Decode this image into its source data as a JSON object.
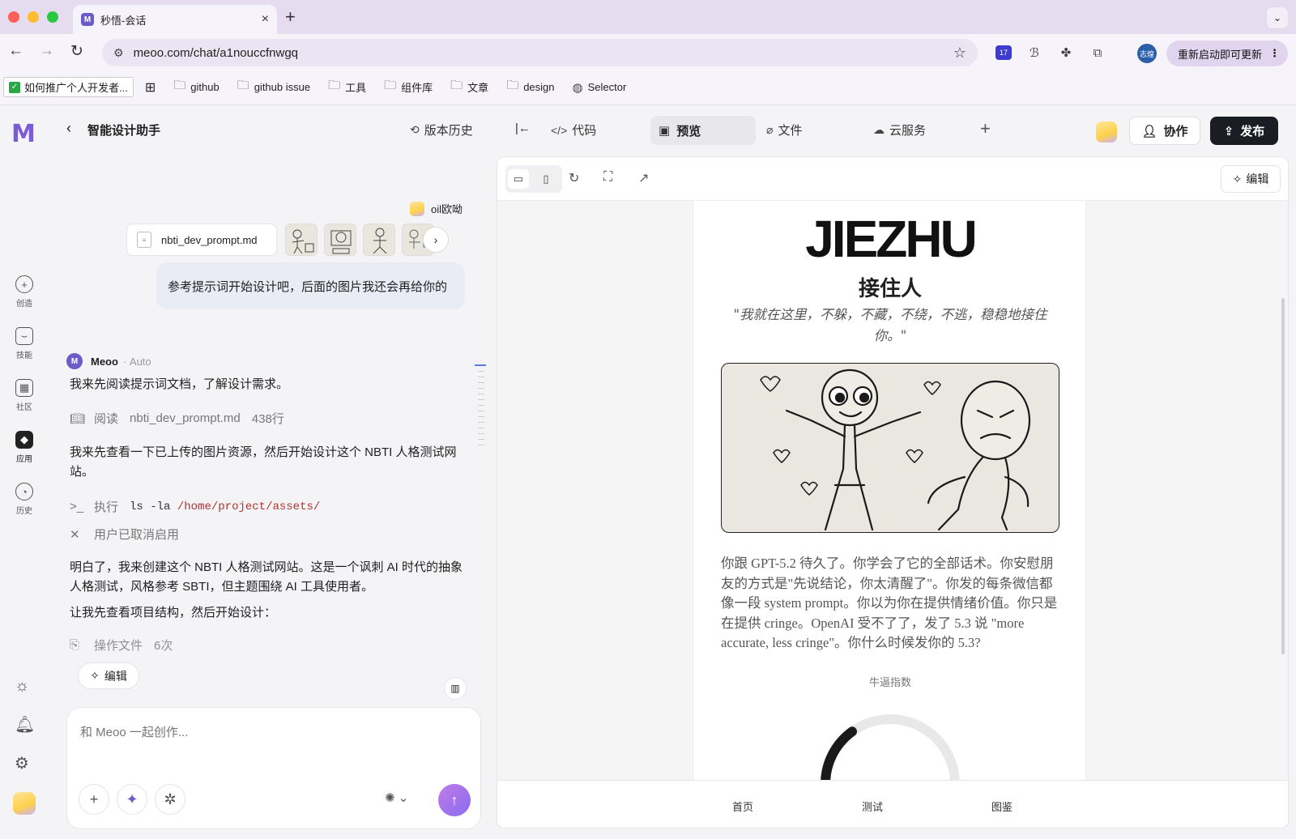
{
  "browser": {
    "tab_title": "秒悟-会话",
    "tab_favicon": "M",
    "url": "meoo.com/chat/a1nouccfnwgq",
    "update_button": "重新启动即可更新",
    "profile": "志煌",
    "ext_badge": "17",
    "bookmarks": [
      "如何推广个人开发者...",
      "github",
      "github issue",
      "工具",
      "组件库",
      "文章",
      "design",
      "Selector"
    ]
  },
  "rail": {
    "logo": "M",
    "items": [
      {
        "label": "创造",
        "icon": "plus-circle-icon"
      },
      {
        "label": "技能",
        "icon": "bag-icon"
      },
      {
        "label": "社区",
        "icon": "grid-icon"
      },
      {
        "label": "应用",
        "icon": "cube-icon"
      },
      {
        "label": "历史",
        "icon": "clock-icon"
      }
    ]
  },
  "header": {
    "title": "智能设计助手",
    "version_history": "版本历史",
    "code": "代码",
    "preview": "预览",
    "files": "文件",
    "cloud": "云服务",
    "collab": "协作",
    "publish": "发布"
  },
  "chat": {
    "user_name": "oil欧呦",
    "attachment": "nbti_dev_prompt.md",
    "user_message": "参考提示词开始设计吧，后面的图片我还会再给你的",
    "assistant_name": "Meoo",
    "assistant_mode": "Auto",
    "msg1": "我来先阅读提示词文档，了解设计需求。",
    "read_label": "阅读",
    "read_file": "nbti_dev_prompt.md",
    "read_lines": "438行",
    "msg2": "我来先查看一下已上传的图片资源，然后开始设计这个 NBTI 人格测试网站。",
    "exec_label": "执行",
    "exec_cmd": "ls",
    "exec_flag": "-la",
    "exec_path": "/home/project/assets/",
    "cancelled": "用户已取消启用",
    "msg3": "明白了，我来创建这个 NBTI 人格测试网站。这是一个讽刺 AI 时代的抽象人格测试，风格参考 SBTI，但主题围绕 AI 工具使用者。",
    "msg4": "让我先查看项目结构，然后开始设计：",
    "ops_label": "操作文件",
    "ops_count": "6次",
    "edit_chip": "编辑",
    "input_placeholder": "和 Meoo 一起创作..."
  },
  "preview": {
    "edit": "编辑",
    "brand": "JIEZHU",
    "subname": "接住人",
    "quote": "\"我就在这里，不躲，不藏，不绕，不逃，稳稳地接住你。\"",
    "description": "你跟 GPT-5.2 待久了。你学会了它的全部话术。你安慰朋友的方式是\"先说结论，你太清醒了\"。你发的每条微信都像一段 system prompt。你以为你在提供情绪价值。你只是在提供 cringe。OpenAI 受不了了，发了 5.3 说 \"more accurate, less cringe\"。你什么时候发你的 5.3?",
    "index_label": "牛逼指数",
    "gauge_fraction": 0.3,
    "nav": [
      "首页",
      "测试",
      "图鉴"
    ]
  },
  "colors": {
    "accent": "#7a5cd9",
    "publish_bg": "#1a1d24",
    "path": "#b0312f"
  }
}
